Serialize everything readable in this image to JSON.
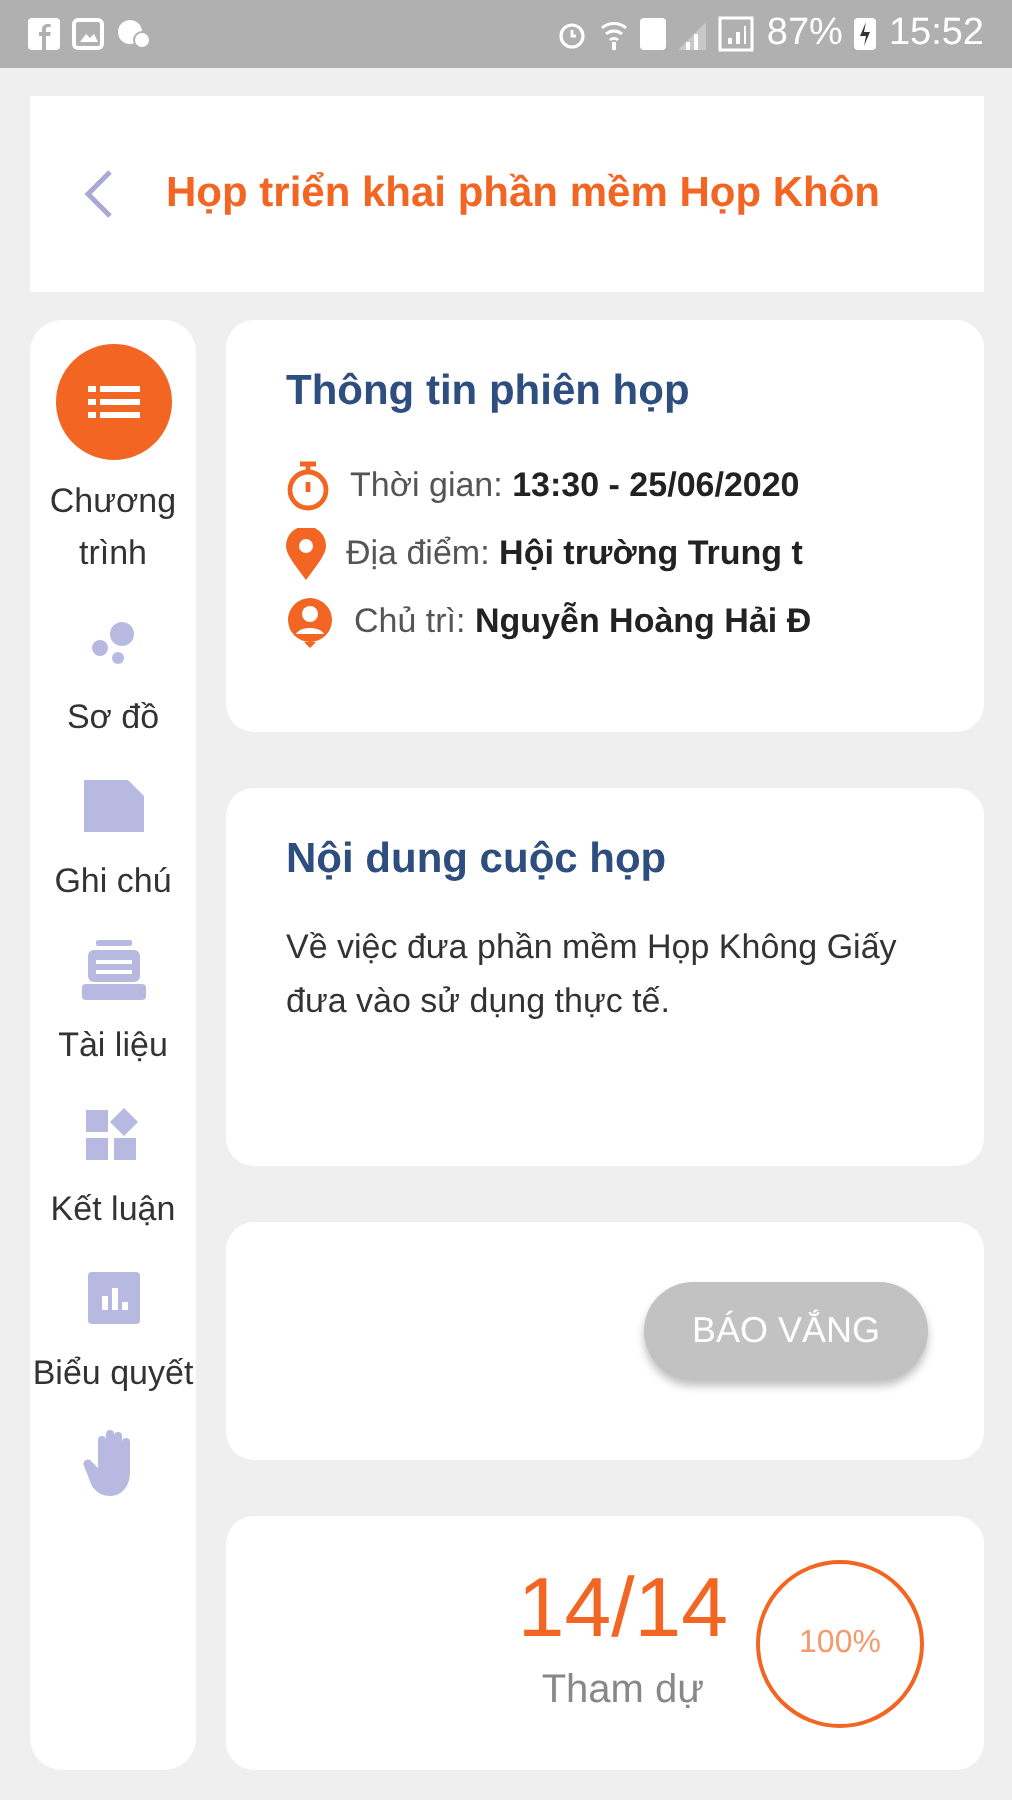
{
  "status_bar": {
    "battery": "87%",
    "time": "15:52"
  },
  "header": {
    "title": "Họp triển khai phần mềm Họp Khôn"
  },
  "sidebar": {
    "items": [
      {
        "label": "Chương trình",
        "selected": true
      },
      {
        "label": "Sơ đồ",
        "selected": false
      },
      {
        "label": "Ghi chú",
        "selected": false
      },
      {
        "label": "Tài liệu",
        "selected": false
      },
      {
        "label": "Kết luận",
        "selected": false
      },
      {
        "label": "Biểu quyết",
        "selected": false
      },
      {
        "selected": false
      }
    ]
  },
  "session_info": {
    "title": "Thông tin phiên họp",
    "rows": [
      {
        "kind": "time",
        "label": "Thời gian:",
        "value": "13:30 - 25/06/2020"
      },
      {
        "kind": "place",
        "label": "Địa điểm:",
        "value": "Hội trường Trung t"
      },
      {
        "kind": "chair",
        "label": "Chủ trì:",
        "value": "Nguyễn Hoàng Hải Đ"
      }
    ]
  },
  "content": {
    "title": "Nội dung cuộc họp",
    "text": "Về việc đưa phần mềm Họp Không Giấy đưa vào sử dụng thực tế."
  },
  "absence": {
    "button": "BÁO VẮNG",
    "disabled": true
  },
  "attendance": {
    "count": "14/14",
    "label": "Tham dự",
    "percent": "100%"
  }
}
